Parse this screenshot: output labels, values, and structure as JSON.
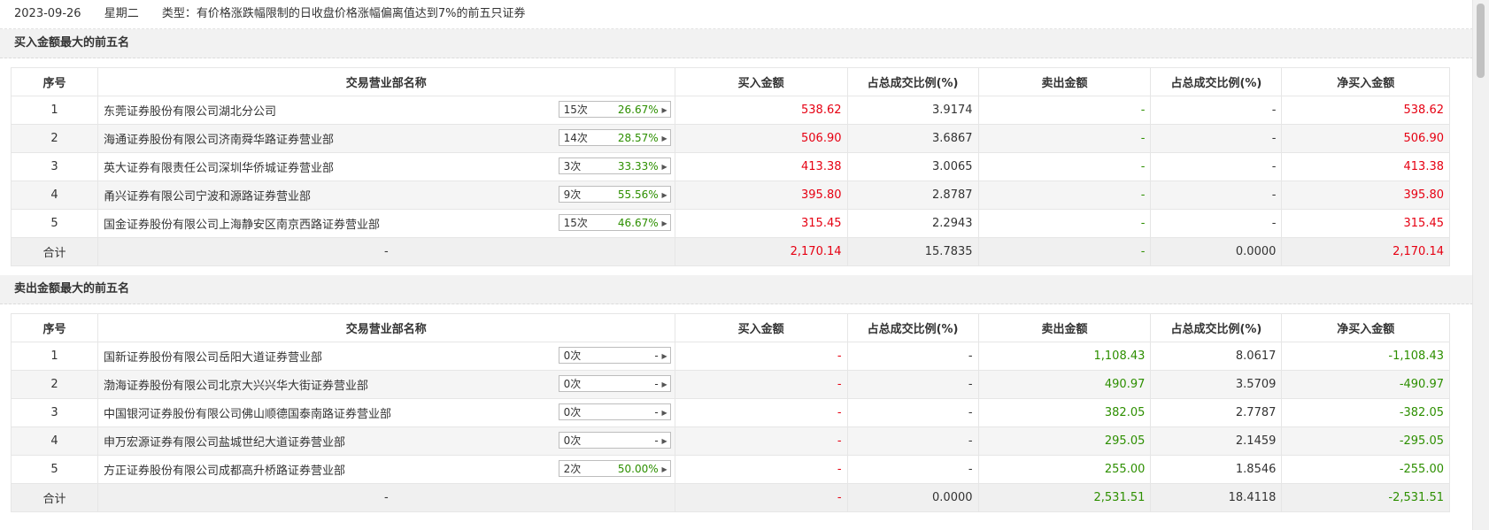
{
  "header": {
    "date": "2023-09-26",
    "weekday": "星期二",
    "type_text": "类型：有价格涨跌幅限制的日收盘价格涨幅偏离值达到7%的前五只证券"
  },
  "columns": {
    "seq": "序号",
    "name": "交易营业部名称",
    "buy": "买入金额",
    "buy_pct": "占总成交比例(%)",
    "sell": "卖出金额",
    "sell_pct": "占总成交比例(%)",
    "net": "净买入金额"
  },
  "buy_section": {
    "title": "买入金额最大的前五名",
    "rows": [
      {
        "seq": "1",
        "name": "东莞证券股份有限公司湖北分公司",
        "times": "15次",
        "rate": "26.67%",
        "buy": "538.62",
        "buy_pct": "3.9174",
        "sell": "-",
        "sell_pct": "-",
        "net": "538.62"
      },
      {
        "seq": "2",
        "name": "海通证券股份有限公司济南舜华路证券营业部",
        "times": "14次",
        "rate": "28.57%",
        "buy": "506.90",
        "buy_pct": "3.6867",
        "sell": "-",
        "sell_pct": "-",
        "net": "506.90"
      },
      {
        "seq": "3",
        "name": "英大证券有限责任公司深圳华侨城证券营业部",
        "times": "3次",
        "rate": "33.33%",
        "buy": "413.38",
        "buy_pct": "3.0065",
        "sell": "-",
        "sell_pct": "-",
        "net": "413.38"
      },
      {
        "seq": "4",
        "name": "甬兴证券有限公司宁波和源路证券营业部",
        "times": "9次",
        "rate": "55.56%",
        "buy": "395.80",
        "buy_pct": "2.8787",
        "sell": "-",
        "sell_pct": "-",
        "net": "395.80"
      },
      {
        "seq": "5",
        "name": "国金证券股份有限公司上海静安区南京西路证券营业部",
        "times": "15次",
        "rate": "46.67%",
        "buy": "315.45",
        "buy_pct": "2.2943",
        "sell": "-",
        "sell_pct": "-",
        "net": "315.45"
      }
    ],
    "total": {
      "label": "合计",
      "name": "-",
      "buy": "2,170.14",
      "buy_pct": "15.7835",
      "sell": "-",
      "sell_pct": "0.0000",
      "net": "2,170.14"
    }
  },
  "sell_section": {
    "title": "卖出金额最大的前五名",
    "rows": [
      {
        "seq": "1",
        "name": "国新证券股份有限公司岳阳大道证券营业部",
        "times": "0次",
        "rate": "-",
        "buy": "-",
        "buy_pct": "-",
        "sell": "1,108.43",
        "sell_pct": "8.0617",
        "net": "-1,108.43"
      },
      {
        "seq": "2",
        "name": "渤海证券股份有限公司北京大兴兴华大街证券营业部",
        "times": "0次",
        "rate": "-",
        "buy": "-",
        "buy_pct": "-",
        "sell": "490.97",
        "sell_pct": "3.5709",
        "net": "-490.97"
      },
      {
        "seq": "3",
        "name": "中国银河证券股份有限公司佛山顺德国泰南路证券营业部",
        "times": "0次",
        "rate": "-",
        "buy": "-",
        "buy_pct": "-",
        "sell": "382.05",
        "sell_pct": "2.7787",
        "net": "-382.05"
      },
      {
        "seq": "4",
        "name": "申万宏源证券有限公司盐城世纪大道证券营业部",
        "times": "0次",
        "rate": "-",
        "buy": "-",
        "buy_pct": "-",
        "sell": "295.05",
        "sell_pct": "2.1459",
        "net": "-295.05"
      },
      {
        "seq": "5",
        "name": "方正证券股份有限公司成都高升桥路证券营业部",
        "times": "2次",
        "rate": "50.00%",
        "buy": "-",
        "buy_pct": "-",
        "sell": "255.00",
        "sell_pct": "1.8546",
        "net": "-255.00"
      }
    ],
    "total": {
      "label": "合计",
      "name": "-",
      "buy": "-",
      "buy_pct": "0.0000",
      "sell": "2,531.51",
      "sell_pct": "18.4118",
      "net": "-2,531.51"
    }
  },
  "colors": {
    "up": "#e60012",
    "down": "#2d8f00",
    "header_bg": "#f2f2f2"
  }
}
